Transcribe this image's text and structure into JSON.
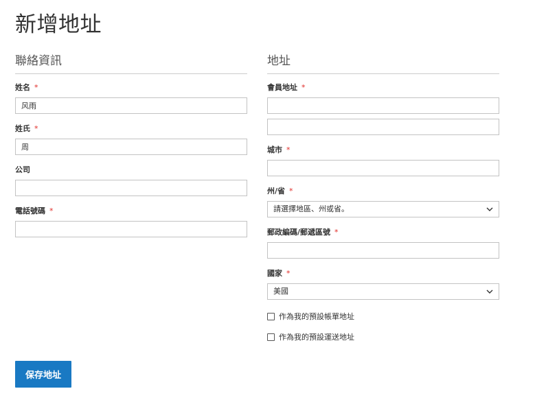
{
  "page": {
    "title": "新增地址"
  },
  "contact": {
    "heading": "聯絡資訊",
    "first_name": {
      "label": "姓名",
      "value": "风雨"
    },
    "last_name": {
      "label": "姓氏",
      "value": "周"
    },
    "company": {
      "label": "公司",
      "value": ""
    },
    "phone": {
      "label": "電話號碼",
      "value": ""
    }
  },
  "address": {
    "heading": "地址",
    "street": {
      "label": "會員地址",
      "line1": "",
      "line2": ""
    },
    "city": {
      "label": "城市",
      "value": ""
    },
    "region": {
      "label": "州/省",
      "selected": "請選擇地區、州或省。"
    },
    "postcode": {
      "label": "郵政編碼/郵遞區號",
      "value": ""
    },
    "country": {
      "label": "國家",
      "selected": "美國"
    },
    "default_billing": {
      "label": "作為我的預設帳單地址",
      "checked": false
    },
    "default_shipping": {
      "label": "作為我的預設運送地址",
      "checked": false
    }
  },
  "actions": {
    "save_label": "保存地址"
  },
  "required_mark": "*",
  "colors": {
    "primary": "#1979c3",
    "required": "#e02b27",
    "border": "#c2c2c2"
  },
  "icons": {
    "dropdown": "chevron-down-icon"
  }
}
